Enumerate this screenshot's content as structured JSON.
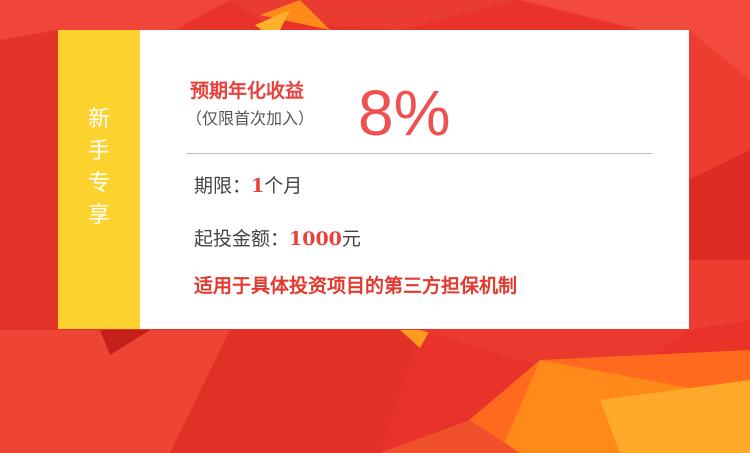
{
  "colors": {
    "background_red": "#e8322a",
    "card_white": "#ffffff",
    "side_yellow": "#fcd22e",
    "accent_red": "#ef5150",
    "orange": "#ff8c1a"
  },
  "sidebar": {
    "label_chars": [
      "新",
      "手",
      "专",
      "享"
    ]
  },
  "rate": {
    "label": "预期年化收益",
    "note": "（仅限首次加入）",
    "value": "8%"
  },
  "details": {
    "term_label": "期限：",
    "term_value": "1",
    "term_unit": "个月",
    "min_label": "起投金额：",
    "min_value": "1000",
    "min_unit": "元",
    "guarantee": "适用于具体投资项目的第三方担保机制"
  }
}
